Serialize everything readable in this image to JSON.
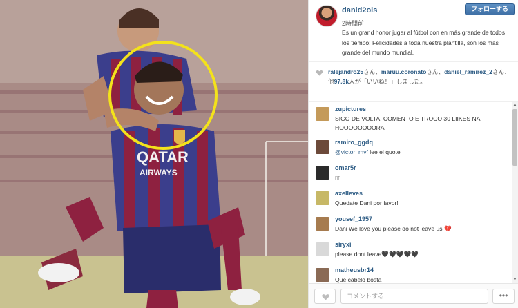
{
  "post": {
    "username": "danid2ois",
    "time": "2時間前",
    "follow_label": "フォローする",
    "caption": "Es un grand honor jugar al fútbol con en más grande de todos los tiempo! Felicidades a toda nuestra plantilla, son los mas grande del mundo mundial."
  },
  "photo": {
    "description_icon": "football-celebration-photo",
    "jersey_text_1": "QATAR",
    "jersey_text_2": "AIRWAYS",
    "highlight_color": "#f3e21b"
  },
  "likes": {
    "user1": "ralejandro25",
    "sep1": "さん、",
    "user2": "maruu.coronato",
    "sep2": "さん、",
    "user3": "daniel_ramirez_2",
    "sep3": "さん、他",
    "count": "97.8k",
    "suffix": "人が「いいね！」しました。"
  },
  "comments": [
    {
      "user": "zupictures",
      "text": "SIGO DE VOLTA. COMENTO E TROCO 30 LIIKES NA HOOOOOOOORA",
      "avatar_color": "#c49a5a"
    },
    {
      "user": "ramiro_ggdq",
      "mention": "@victor_mvf",
      "text": " lee el quote",
      "avatar_color": "#6c4a3a"
    },
    {
      "user": "omar5r",
      "text": "",
      "avatar_color": "#2b2b2b"
    },
    {
      "user": "axelleves",
      "text": "Quedate Dani por favor!",
      "avatar_color": "#c7b866"
    },
    {
      "user": "yousef_1957",
      "text": "Dani We love you please do not leave us 💔",
      "avatar_color": "#a67b4f"
    },
    {
      "user": "siryxi",
      "text": "please dont leave🖤🖤🖤🖤🖤",
      "avatar_color": "#d9d9d9"
    },
    {
      "user": "matheusbr14",
      "text": "Que cabelo bosta",
      "avatar_color": "#8a6a55"
    }
  ],
  "footer": {
    "comment_placeholder": "コメントする...",
    "more_label": "•••"
  },
  "colors": {
    "link": "#2b5a83",
    "follow_button": "#4a7db3"
  }
}
